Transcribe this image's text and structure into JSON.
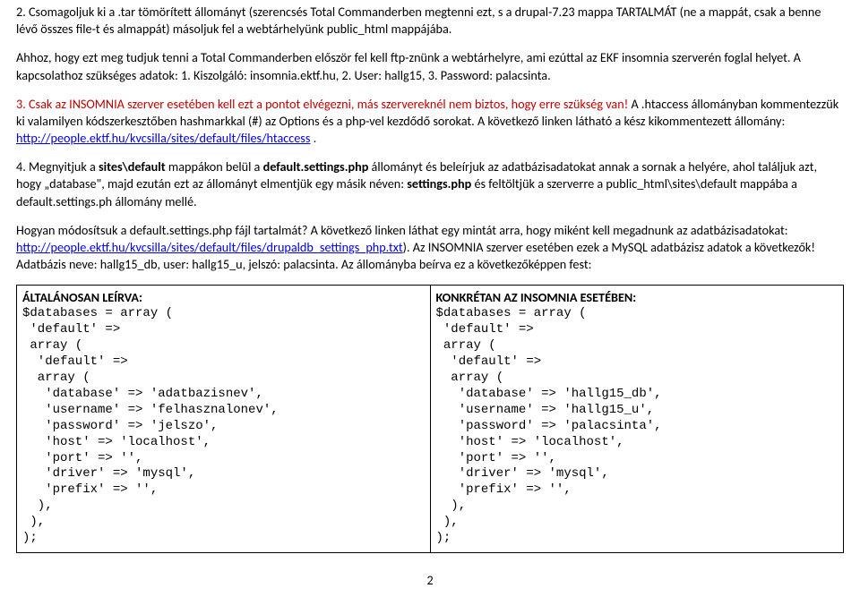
{
  "para1_a": "2. Csomagoljuk ki a .tar tömörített állományt (szerencsés Total Commanderben megtenni ezt, s a drupal-7.23 mappa TARTALMÁT (ne a mappát, csak a benne lévő összes file-t és almappát) másoljuk fel a webtárhelyünk public_html mappájába.",
  "para2_a": "Ahhoz, hogy ezt meg tudjuk tenni a Total Commanderben először fel kell ftp-znünk a webtárhelyre, ami ezúttal az EKF insomnia szerverén foglal helyet. A kapcsolathoz szükséges adatok: 1. Kiszolgáló: insomnia.ektf.hu, 2. User: hallg15, 3. Password: palacsinta.",
  "para3_red": "3. Csak az INSOMNIA szerver esetében kell ezt a pontot elvégezni, más szervereknél nem biztos, hogy erre szükség van!",
  "para3_b1": " A .htaccess állományban kommentezzük ki valamilyen kódszerkesztőben hashmarkkal (#) az Options és a php-vel kezdődő sorokat. A következő linken látható a kész kikommentezett állomány: ",
  "para3_link": "http://people.ektf.hu/kvcsilla/sites/default/files/htaccess",
  "para3_b2": ".",
  "para4_a": "4. Megnyitjuk a ",
  "para4_b": "sites\\default",
  "para4_c": " mappákon belül a ",
  "para4_d": "default.settings.php",
  "para4_e": " állományt és beleírjuk az adatbázisadatokat annak a sornak a helyére, ahol találjuk azt, hogy „database\", majd ezután ezt az állományt elmentjük egy másik néven: ",
  "para4_f": "settings.php",
  "para4_g": " és feltöltjük a szerverre a public_html\\sites\\default mappába a default.settings.ph állomány mellé.",
  "para5_a": "Hogyan módosítsuk a default.settings.php fájl tartalmát? A következő linken láthat egy mintát arra, hogy miként kell megadnunk az adatbázisadatokat: ",
  "para5_link": "http://people.ektf.hu/kvcsilla/sites/default/files/drupaldb_settings_php.txt",
  "para5_b": "). Az INSOMNIA szerver esetében ezek a MySQL adatbázisz adatok a következők!  Adatbázis neve: hallg15_db, user: hallg15_u, jelszó: palacsinta.  Az állományba beírva ez a következőképpen fest:",
  "col1_head": "ÁLTALÁNOSAN LEÍRVA:",
  "col1_code": "$databases = array (\n 'default' =>\n array (\n  'default' =>\n  array (\n   'database' => 'adatbazisnev',\n   'username' => 'felhasznalonev',\n   'password' => 'jelszo',\n   'host' => 'localhost',\n   'port' => '',\n   'driver' => 'mysql',\n   'prefix' => '',\n  ),\n ),\n);",
  "col2_head": "KONKRÉTAN AZ INSOMNIA ESETÉBEN:",
  "col2_code": "$databases = array (\n 'default' =>\n array (\n  'default' =>\n  array (\n   'database' => 'hallg15_db',\n   'username' => 'hallg15_u',\n   'password' => 'palacsinta',\n   'host' => 'localhost',\n   'port' => '',\n   'driver' => 'mysql',\n   'prefix' => '',\n  ),\n ),\n);",
  "page_number": "2"
}
